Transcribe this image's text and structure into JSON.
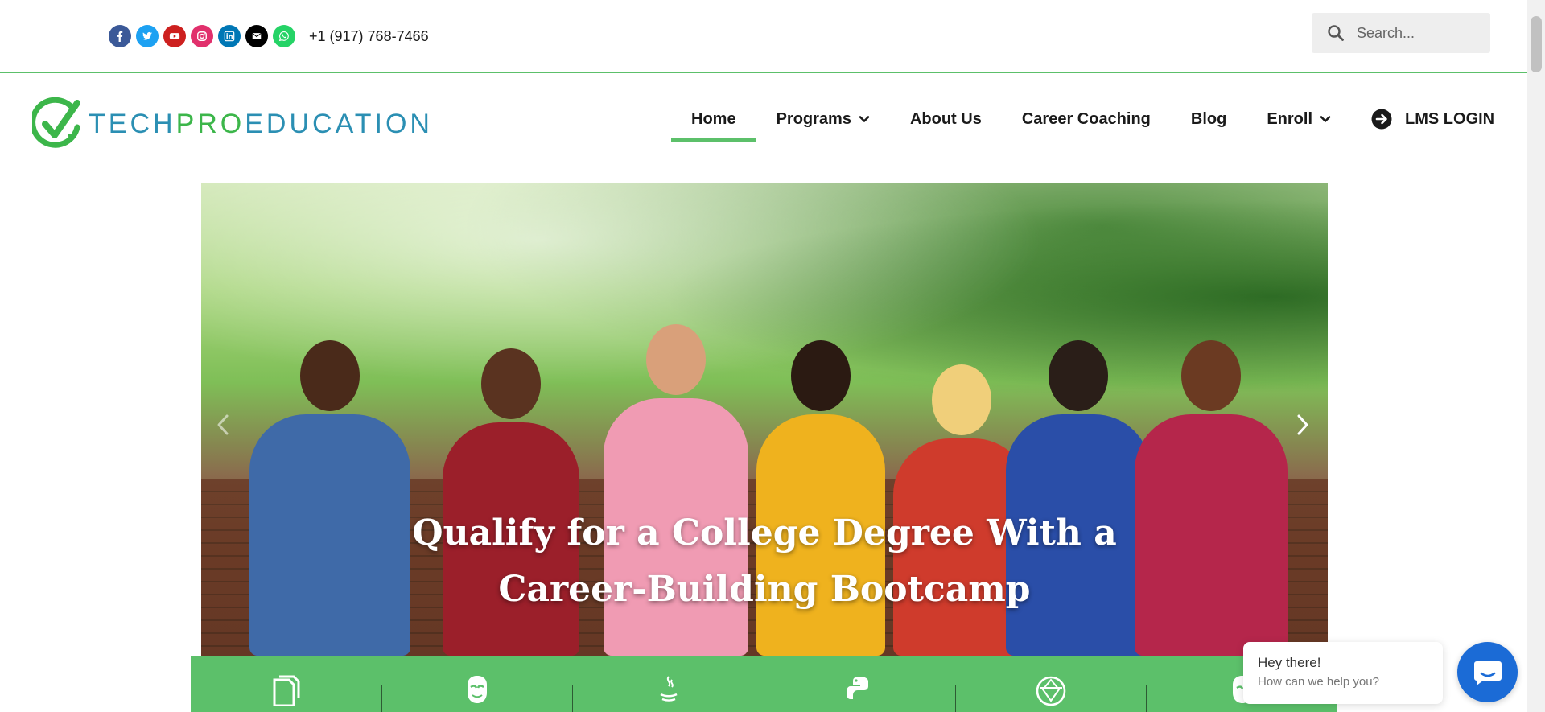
{
  "topbar": {
    "socials": [
      {
        "icon": "facebook-icon",
        "color": "#3b5998"
      },
      {
        "icon": "twitter-icon",
        "color": "#1da1f2"
      },
      {
        "icon": "youtube-icon",
        "color": "#cd201f"
      },
      {
        "icon": "instagram-icon",
        "color": "#e1306c"
      },
      {
        "icon": "linkedin-icon",
        "color": "#0077b5"
      },
      {
        "icon": "envelope-icon",
        "color": "#000000"
      },
      {
        "icon": "whatsapp-icon",
        "color": "#25d366"
      }
    ],
    "phone": "+1 (917) 768-7466",
    "search_placeholder": "Search..."
  },
  "logo": {
    "tech": "TECH",
    "pro": "PRO",
    "edu": "EDUCATION"
  },
  "nav": {
    "items": [
      {
        "label": "Home",
        "active": true
      },
      {
        "label": "Programs",
        "dropdown": true
      },
      {
        "label": "About Us"
      },
      {
        "label": "Career Coaching"
      },
      {
        "label": "Blog"
      },
      {
        "label": "Enroll",
        "dropdown": true
      }
    ],
    "lms_label": "LMS LOGIN"
  },
  "hero": {
    "title_line1": "Qualify for a College Degree With a",
    "title_line2": "Career-Building Bootcamp"
  },
  "strip": {
    "icons": [
      "documents-icon",
      "hacker-mask-icon",
      "java-icon",
      "python-icon",
      "network-globe-icon",
      "shield-icon"
    ]
  },
  "chat": {
    "greeting": "Hey there!",
    "prompt": "How can we help you?"
  },
  "colors": {
    "accent_green": "#5cc06a",
    "brand_blue": "#2b8fb3",
    "chat_blue": "#1b6bd6"
  }
}
